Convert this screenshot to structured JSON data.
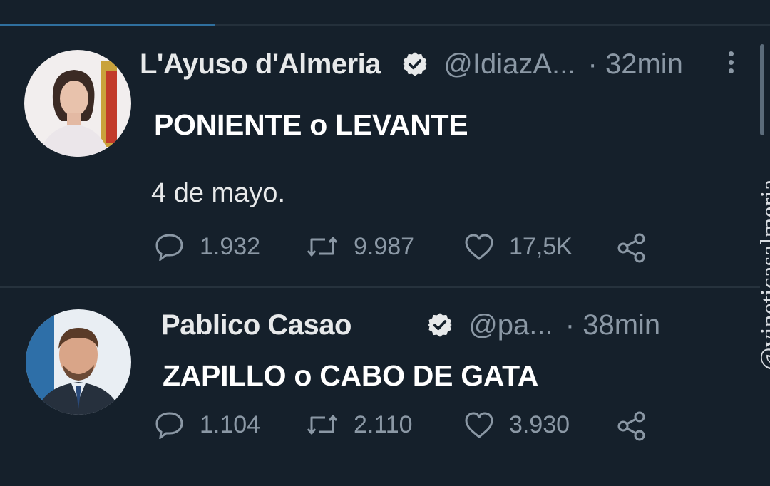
{
  "tweets": [
    {
      "display_name": "L'Ayuso d'Almeria",
      "handle": "@IdiazA...",
      "separator": "·",
      "time": "32min",
      "text": "PONIENTE o LEVANTE",
      "date_line": "4 de mayo.",
      "replies": "1.932",
      "retweets": "9.987",
      "likes": "17,5K"
    },
    {
      "display_name": "Pablico Casao",
      "handle": "@pa...",
      "separator": "·",
      "time": "38min",
      "text": "ZAPILLO o CABO DE GATA",
      "replies": "1.104",
      "retweets": "2.110",
      "likes": "3.930"
    }
  ],
  "watermark": "@vineticasalmeria",
  "colors": {
    "background": "#15202b",
    "secondary_text": "#8b98a5",
    "primary_text": "#e7e9ea"
  },
  "icons": [
    "verified-badge-icon",
    "more-options-icon",
    "reply-icon",
    "retweet-icon",
    "like-icon",
    "share-icon"
  ]
}
